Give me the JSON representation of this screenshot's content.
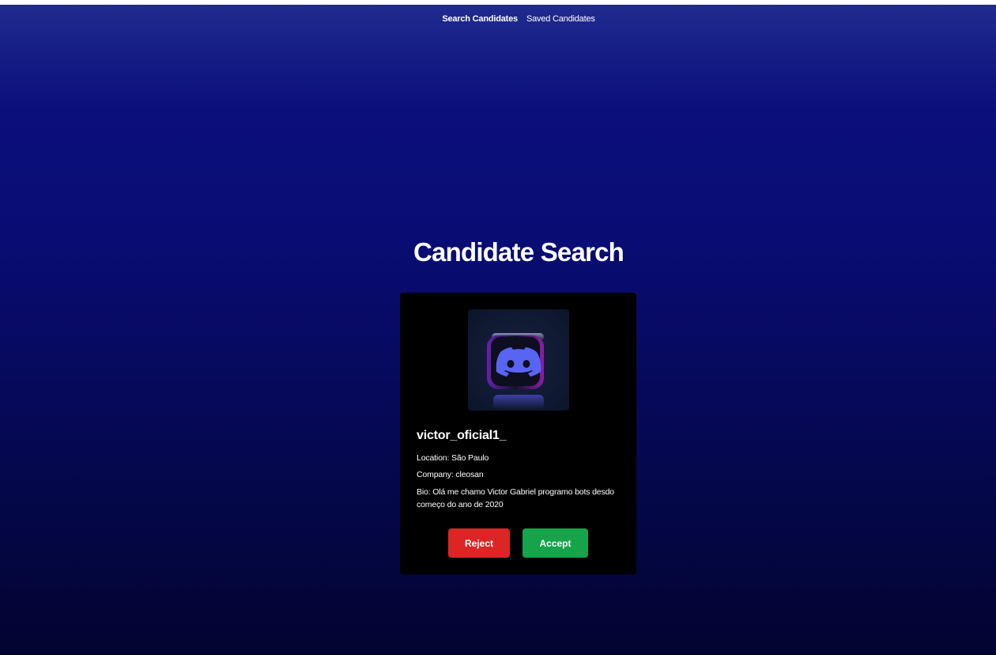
{
  "nav": {
    "items": [
      {
        "label": "Search Candidates",
        "active": true
      },
      {
        "label": "Saved Candidates",
        "active": false
      }
    ]
  },
  "page_title": "Candidate Search",
  "candidate": {
    "avatar_icon": "discord-logo-icon",
    "username": "victor_oficial1_",
    "location": "Location: São Paulo",
    "company": "Company: cleosan",
    "bio": "Bio: Olá me chamo Victor Gabriel programo bots desdo começo do ano de 2020"
  },
  "actions": {
    "reject_label": "Reject",
    "accept_label": "Accept"
  },
  "colors": {
    "background_top": "#1f2b8e",
    "background_bottom": "#020430",
    "card": "#000000",
    "reject": "#dc2626",
    "accept": "#16a34a",
    "discord_blurple": "#5865f2"
  }
}
